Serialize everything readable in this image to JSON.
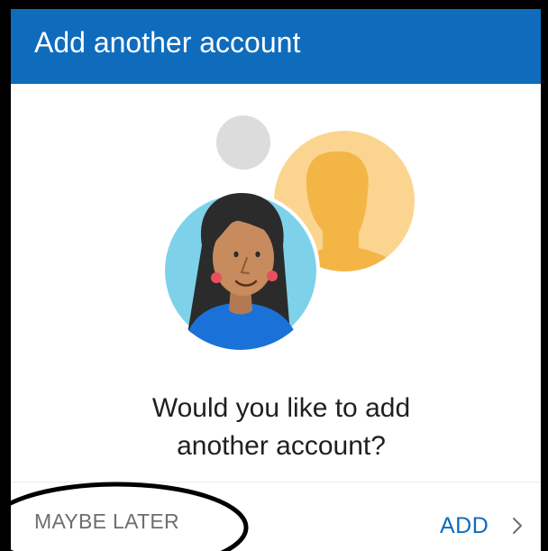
{
  "dialog": {
    "title": "Add another account",
    "question_line1": "Would you like to add",
    "question_line2": "another account?",
    "maybe_later_label": "MAYBE LATER",
    "add_label": "ADD"
  },
  "colors": {
    "header_bg": "#0f6cbd",
    "add_text": "#0f6cbd",
    "maybe_later_text": "#6e6e6e",
    "annotation_ellipse": "#000000"
  },
  "icons": {
    "add_arrow": "chevron-right-icon",
    "illustration": "people-accounts-illustration"
  }
}
